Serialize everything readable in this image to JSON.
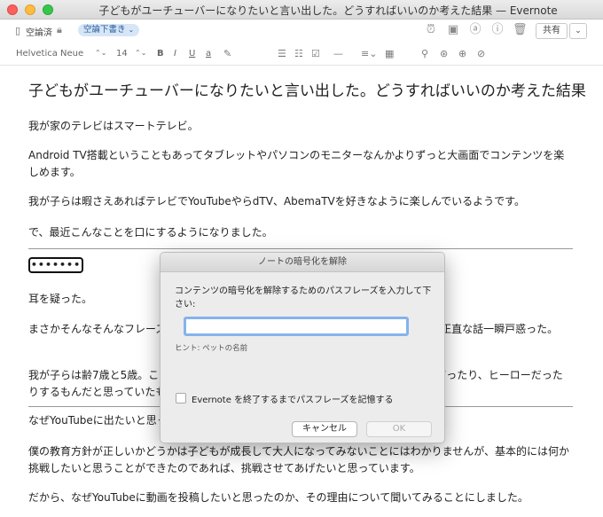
{
  "window": {
    "title": "子どもがユーチューバーになりたいと言い出した。どうすればいいのか考えた結果 — Evernote"
  },
  "note_toolbar": {
    "notebook_icon": "notebook-icon",
    "notebook_name": "空論済",
    "lock_icon": "lock-icon",
    "tag_label": "空論下書き",
    "tag_chevron": "⌄",
    "right_icons": [
      "reminder-icon",
      "presentation-icon",
      "at-icon",
      "info-icon",
      "trash-icon"
    ],
    "share_label": "共有",
    "share_dropdown": "⌄"
  },
  "format_toolbar": {
    "font_family": "Helvetica Neue",
    "font_size": "14",
    "stepper": "⌃⌄",
    "bold": "B",
    "italic": "I",
    "underline": "U",
    "text_color": "a",
    "highlight_icon": "highlighter-icon",
    "list_icons": [
      "bullet-list-icon",
      "numbered-list-icon",
      "checkbox-icon",
      "divider-icon",
      "align-icon",
      "table-icon"
    ],
    "extra_icons": [
      "attachment-icon",
      "link-icon",
      "encrypt-icon"
    ]
  },
  "note": {
    "title": "子どもがユーチューバーになりたいと言い出した。どうすればいいのか考えた結果",
    "paragraphs": [
      "我が家のテレビはスマートテレビ。",
      "Android TV搭載ということもあってタブレットやパソコンのモニターなんかよりずっと大画面でコンテンツを楽しめます。",
      "我が子らは暇さえあればテレビでYouTubeやらdTV、AbemaTVを好きなように楽しんでいるようです。",
      "で、最近こんなことを口にするようになりました。",
      "耳を疑った。",
      "まさかそんなそんなフレーズが子どもの口から出てくるとは思ってもみなかったので、正直な話一瞬戸惑った。",
      "我が子らは齢7歳と5歳。このくらいの年頃なら、将来の夢は野球選手やサッカー選手だったり、ヒーローだったりするもんだと思っていたもの。",
      "なぜYouTubeに出たいと思ったのか。",
      "僕の教育方針が正しいかどうかは子どもが成長して大人になってみないことにはわかりませんが、基本的には何か挑戦したいと思うことができたのであれば、挑戦させてあげたいと思っています。",
      "だから、なぜYouTubeに動画を投稿したいと思ったのか、その理由について聞いてみることにしました。"
    ],
    "encrypted_text": "•••••••"
  },
  "dialog": {
    "title": "ノートの暗号化を解除",
    "message": "コンテンツの暗号化を解除するためのパスフレーズを入力して下さい:",
    "input_value": "",
    "hint": "ヒント:  ペットの名前",
    "checkbox_label": "Evernote を終了するまでパスフレーズを記憶する",
    "checkbox_checked": false,
    "cancel_label": "キャンセル",
    "ok_label": "OK"
  }
}
